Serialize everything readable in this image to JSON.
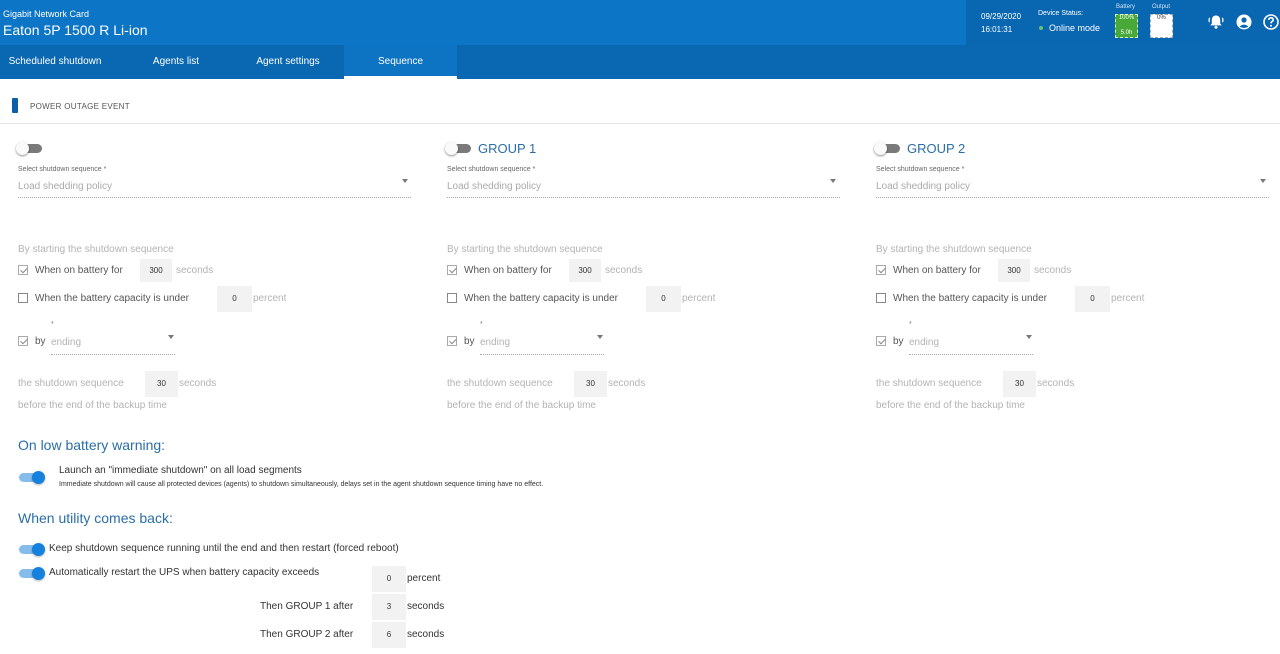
{
  "header": {
    "subtitle": "Gigabit Network Card",
    "title": "Eaton 5P 1500 R Li-ion",
    "date": "09/29/2020",
    "time": "16:01:31",
    "device_status_label": "Device Status:",
    "device_status": "Online mode",
    "battery_label": "Battery",
    "battery_percent": "100%",
    "battery_runtime": "5.0h",
    "output_label": "Output",
    "output_percent": "0%",
    "icons": [
      "bell-icon",
      "user-icon",
      "help-icon"
    ]
  },
  "tabs": [
    {
      "label": "Scheduled shutdown",
      "active": false
    },
    {
      "label": "Agents list",
      "active": false
    },
    {
      "label": "Agent settings",
      "active": false
    },
    {
      "label": "Sequence",
      "active": true
    }
  ],
  "event_label": "POWER OUTAGE EVENT",
  "groups": [
    {
      "title": "",
      "enabled": false,
      "select_label": "Select shutdown sequence *",
      "select_value": "Load shedding policy",
      "start_heading": "By starting the shutdown sequence",
      "on_battery_label": "When on battery for",
      "on_battery_value": "300",
      "on_battery_unit": "seconds",
      "on_battery_checked": true,
      "capacity_label": "When the battery capacity is under",
      "capacity_value": "0",
      "capacity_unit": "percent",
      "capacity_checked": false,
      "by_label": "by",
      "by_value": "ending",
      "by_checked": true,
      "seq_label": "the shutdown sequence",
      "seq_value": "30",
      "seq_unit": "seconds",
      "backup_text": "before the end of the backup time"
    },
    {
      "title": "GROUP 1",
      "enabled": false,
      "select_label": "Select shutdown sequence *",
      "select_value": "Load shedding policy",
      "start_heading": "By starting the shutdown sequence",
      "on_battery_label": "When on battery for",
      "on_battery_value": "300",
      "on_battery_unit": "seconds",
      "on_battery_checked": true,
      "capacity_label": "When the battery capacity is under",
      "capacity_value": "0",
      "capacity_unit": "percent",
      "capacity_checked": false,
      "by_label": "by",
      "by_value": "ending",
      "by_checked": true,
      "seq_label": "the shutdown sequence",
      "seq_value": "30",
      "seq_unit": "seconds",
      "backup_text": "before the end of the backup time"
    },
    {
      "title": "GROUP 2",
      "enabled": false,
      "select_label": "Select shutdown sequence *",
      "select_value": "Load shedding policy",
      "start_heading": "By starting the shutdown sequence",
      "on_battery_label": "When on battery for",
      "on_battery_value": "300",
      "on_battery_unit": "seconds",
      "on_battery_checked": true,
      "capacity_label": "When the battery capacity is under",
      "capacity_value": "0",
      "capacity_unit": "percent",
      "capacity_checked": false,
      "by_label": "by",
      "by_value": "ending",
      "by_checked": true,
      "seq_label": "the shutdown sequence",
      "seq_value": "30",
      "seq_unit": "seconds",
      "backup_text": "before the end of the backup time"
    }
  ],
  "low_battery": {
    "title": "On low battery warning:",
    "immediate_label": "Launch an \"immediate shutdown\" on all load segments",
    "immediate_note": "Immediate shutdown will cause all protected devices (agents) to shutdown simultaneously, delays set in the agent shutdown sequence timing have no effect.",
    "immediate_enabled": true
  },
  "utility_back": {
    "title": "When utility comes back:",
    "keep_label": "Keep shutdown sequence running until the end and then restart (forced reboot)",
    "keep_enabled": true,
    "restart_label": "Automatically restart the UPS when battery capacity exceeds",
    "restart_enabled": true,
    "restart_value": "0",
    "restart_unit": "percent",
    "group1_label": "Then GROUP 1 after",
    "group1_value": "3",
    "group1_unit": "seconds",
    "group2_label": "Then GROUP 2 after",
    "group2_value": "6",
    "group2_unit": "seconds"
  },
  "colors": {
    "header_blue": "#0c75c6",
    "tab_bar_blue": "#0a68b3",
    "accent_blue": "#2a6ea8",
    "switch_on": "#1680de",
    "battery_green": "#48a838"
  }
}
